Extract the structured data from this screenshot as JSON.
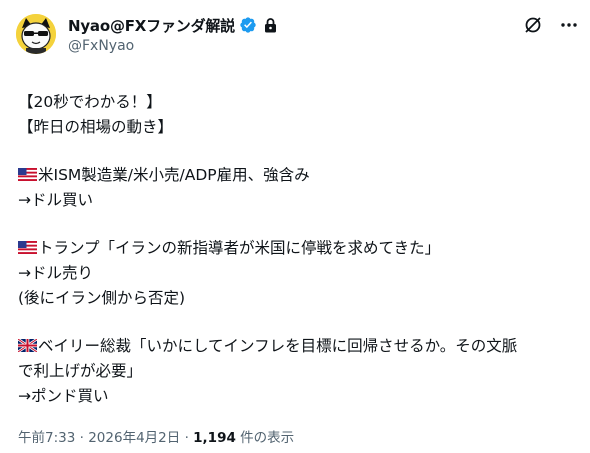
{
  "author": {
    "display_name": "Nyao@FXファンダ解説",
    "handle": "@FxNyao",
    "verified_icon": "verified-badge-icon",
    "protected_icon": "lock-icon"
  },
  "actions": {
    "grok_icon": "grok-icon",
    "more_icon": "more-icon"
  },
  "post": {
    "line1": "【20秒でわかる！】",
    "line2": "【昨日の相場の動き】",
    "us1": "米ISM製造業/米小売/ADP雇用、強含み",
    "us1_arrow": "→ドル買い",
    "us2": "トランプ「イランの新指導者が米国に停戦を求めてきた」",
    "us2_arrow": "→ドル売り",
    "us2_note": "(後にイラン側から否定)",
    "uk1": "ベイリー総裁「いかにしてインフレを目標に回帰させるか。その文脈",
    "uk1_cont": "で利上げが必要」",
    "uk1_arrow": "→ポンド買い"
  },
  "meta": {
    "time": "午前7:33",
    "sep": "·",
    "date": "2026年4月2日",
    "views_count": "1,194",
    "views_label": "件の表示"
  },
  "colors": {
    "verified": "#1d9bf0",
    "text": "#0f1419",
    "secondary": "#536471"
  }
}
